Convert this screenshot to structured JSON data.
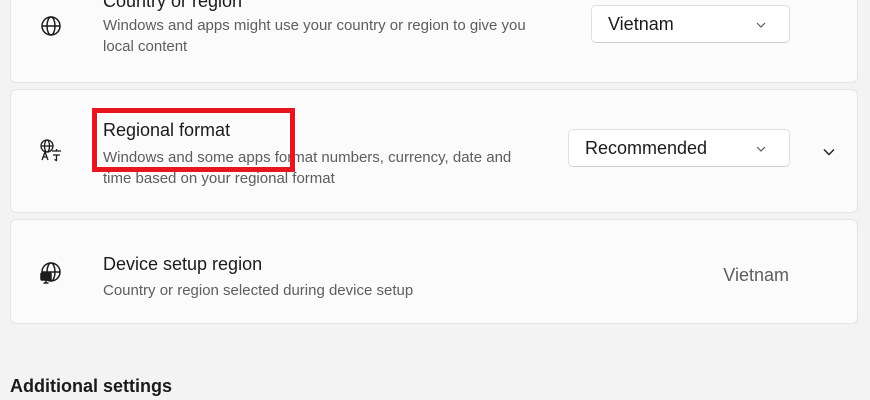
{
  "country_region": {
    "title": "Country or region",
    "description": "Windows and apps might use your country or region to give you local content",
    "selected": "Vietnam",
    "icon": "globe-icon"
  },
  "regional_format": {
    "title": "Regional format",
    "description": "Windows and some apps format numbers, currency, date and time based on your regional format",
    "selected": "Recommended",
    "icon": "language-globe-icon"
  },
  "device_setup_region": {
    "title": "Device setup region",
    "description": "Country or region selected during device setup",
    "value": "Vietnam",
    "icon": "globe-monitor-icon"
  },
  "additional_settings": {
    "title": "Additional settings"
  },
  "colors": {
    "highlight": "#e8141f",
    "card_bg": "#fbfbfb",
    "page_bg": "#f3f3f3"
  }
}
